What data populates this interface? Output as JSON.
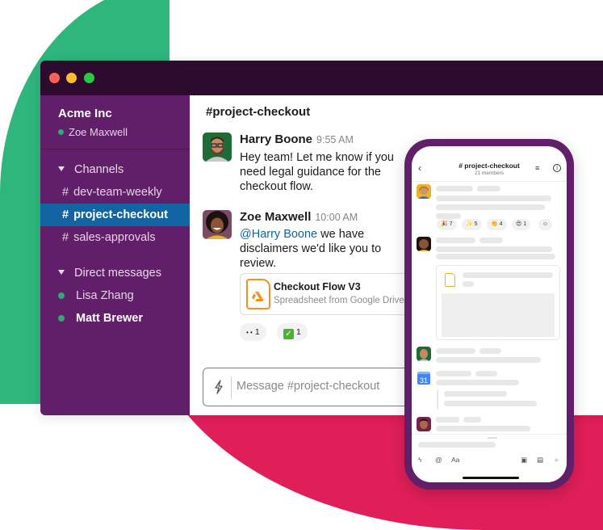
{
  "workspace": {
    "name": "Acme Inc",
    "current_user": "Zoe Maxwell"
  },
  "sidebar": {
    "channels_header": "Channels",
    "channels": [
      {
        "label": "dev-team-weekly",
        "active": false
      },
      {
        "label": "project-checkout",
        "active": true
      },
      {
        "label": "sales-approvals",
        "active": false
      }
    ],
    "dm_header": "Direct messages",
    "direct_messages": [
      {
        "label": "Lisa Zhang",
        "unread": false
      },
      {
        "label": "Matt Brewer",
        "unread": true
      }
    ],
    "hash": "#"
  },
  "channel": {
    "title": "#project-checkout",
    "messages": [
      {
        "author": "Harry Boone",
        "time": "9:55 AM",
        "text": "Hey team! Let me know if you need legal guidance for the checkout flow."
      },
      {
        "author": "Zoe Maxwell",
        "time": "10:00 AM",
        "mention": "@Harry Boone",
        "text": " we have disclaimers we'd like you to review."
      }
    ],
    "attachment": {
      "title": "Checkout Flow V3",
      "subtitle": "Spreadsheet from Google Drive"
    },
    "reactions": [
      {
        "emoji": "eyes",
        "glyph": "• •",
        "count": "1"
      },
      {
        "emoji": "white-check-mark",
        "glyph": "✓",
        "count": "1"
      }
    ],
    "composer_placeholder": "Message #project-checkout"
  },
  "phone": {
    "title": "# project-checkout",
    "subtitle": "21 members",
    "reactions": [
      {
        "emoji": "tada",
        "glyph": "🎉",
        "count": "7"
      },
      {
        "emoji": "sparkles",
        "glyph": "✨",
        "count": "5"
      },
      {
        "emoji": "clap",
        "glyph": "👏",
        "count": "4"
      },
      {
        "emoji": "heart-eyes",
        "glyph": "😍",
        "count": "1"
      }
    ],
    "calendar_day": "31",
    "toolbar": {
      "format": "Aa",
      "at": "@"
    }
  },
  "colors": {
    "sidebar": "#611f69",
    "titlebar": "#2d0b2e",
    "active_channel": "#1264a3",
    "presence": "#2bac76",
    "green_blob": "#2eb67d",
    "red_blob": "#e01e5a",
    "mention": "#1264a3"
  }
}
